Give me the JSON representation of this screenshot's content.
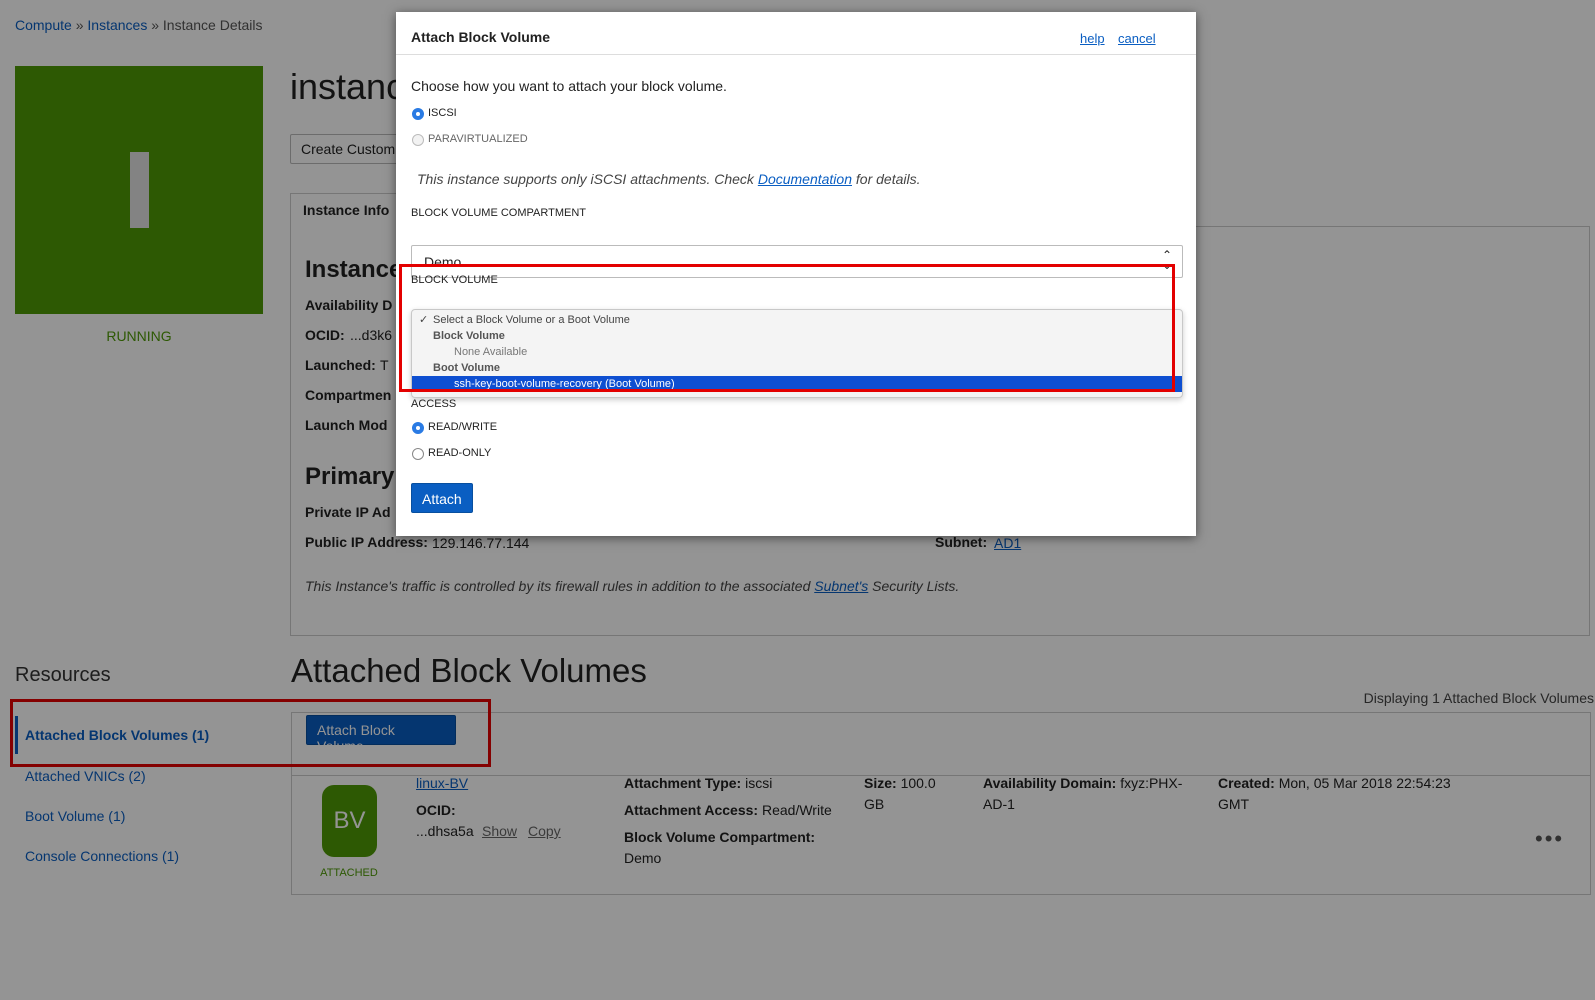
{
  "breadcrumb": {
    "compute": "Compute",
    "sep1": "»",
    "instances": "Instances",
    "sep2": "»",
    "current": "Instance Details"
  },
  "instance": {
    "tile_letter": "I",
    "state": "RUNNING",
    "title": "instance",
    "custom_button": "Create Custom",
    "tab": "Instance Info"
  },
  "info": {
    "heading": "Instance",
    "availability_label": "Availability D",
    "ocid_label": "OCID:",
    "ocid_value": "...d3k6",
    "launched_label": "Launched:",
    "launched_value": "T",
    "compartment_label": "Compartmen",
    "launch_mode_label": "Launch Mod"
  },
  "primary": {
    "heading": "Primary",
    "private_ip_label": "Private IP Ad",
    "public_ip_label": "Public IP Address:",
    "public_ip_value": "129.146.77.144",
    "subnet_label": "Subnet:",
    "subnet_value": "AD1",
    "note_prefix": "This Instance's traffic is controlled by its firewall rules in addition to the associated ",
    "note_link": "Subnet's",
    "note_suffix": " Security Lists."
  },
  "resources": {
    "heading": "Resources",
    "items": [
      {
        "label": "Attached Block Volumes (1)"
      },
      {
        "label": "Attached VNICs (2)"
      },
      {
        "label": "Boot Volume (1)"
      },
      {
        "label": "Console Connections (1)"
      }
    ]
  },
  "attached": {
    "heading": "Attached Block Volumes",
    "displaying": "Displaying 1 Attached Block Volumes",
    "attach_button": "Attach Block Volume",
    "row": {
      "icon_text": "BV",
      "state": "ATTACHED",
      "name": "linux-BV",
      "ocid_label": "OCID:",
      "ocid_value": "...dhsa5a",
      "show": "Show",
      "copy": "Copy",
      "attachment_type_label": "Attachment Type:",
      "attachment_type_value": "iscsi",
      "attachment_access_label": "Attachment Access:",
      "attachment_access_value": "Read/Write",
      "bv_compartment_label": "Block Volume Compartment:",
      "bv_compartment_value": "Demo",
      "size_label": "Size:",
      "size_value": "100.0",
      "size_unit": "GB",
      "ad_label": "Availability Domain:",
      "ad_value": "fxyz:PHX-",
      "ad_value2": "AD-1",
      "created_label": "Created:",
      "created_value": "Mon, 05 Mar 2018 22:54:23",
      "created_value2": "GMT",
      "actions": "•••"
    }
  },
  "modal": {
    "title": "Attach Block Volume",
    "help": "help",
    "cancel": "cancel",
    "prompt": "Choose how you want to attach your block volume.",
    "attach_types": [
      {
        "label": "ISCSI",
        "selected": true
      },
      {
        "label": "PARAVIRTUALIZED",
        "selected": false
      }
    ],
    "support_note_prefix": "This instance supports only iSCSI attachments. Check ",
    "support_note_link": "Documentation",
    "support_note_suffix": " for details.",
    "compartment_label": "BLOCK VOLUME COMPARTMENT",
    "compartment_value": "Demo",
    "volume_label": "BLOCK VOLUME",
    "dropdown": {
      "placeholder_check": "✓",
      "placeholder": "Select a Block Volume or a Boot Volume",
      "group_block": "Block Volume",
      "none_available": "None Available",
      "group_boot": "Boot Volume",
      "selected_option": "ssh-key-boot-volume-recovery (Boot Volume)"
    },
    "access_label": "ACCESS",
    "access_options": [
      {
        "label": "READ/WRITE",
        "selected": true
      },
      {
        "label": "READ-ONLY",
        "selected": false
      }
    ],
    "attach_button": "Attach"
  },
  "colors": {
    "accent": "#0a5ec2",
    "running": "#4e9a06",
    "highlight": "#e30000",
    "selected_option": "#0e4fd1"
  }
}
